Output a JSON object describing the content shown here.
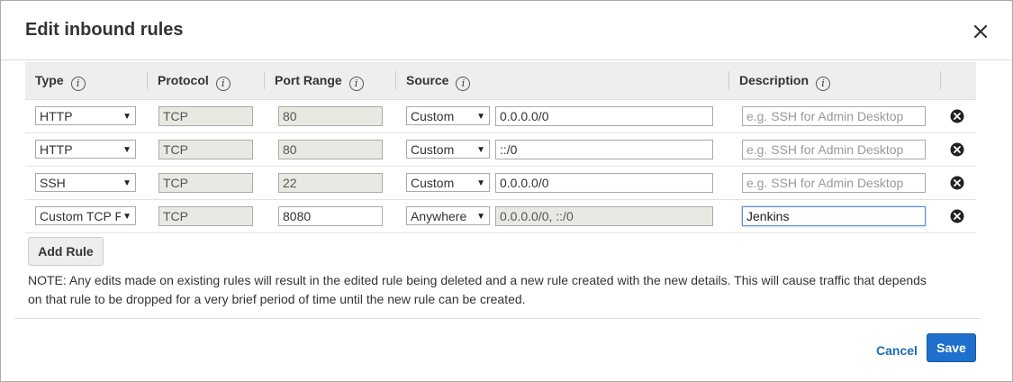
{
  "dialog": {
    "title": "Edit inbound rules",
    "close_icon": "close-icon"
  },
  "table": {
    "headers": {
      "type": "Type",
      "protocol": "Protocol",
      "port_range": "Port Range",
      "source": "Source",
      "description": "Description"
    },
    "info_glyph": "i",
    "rows": [
      {
        "type": "HTTP",
        "protocol": "TCP",
        "port": "80",
        "source_mode": "Custom",
        "source_value": "0.0.0.0/0",
        "description_value": "",
        "description_placeholder": "e.g. SSH for Admin Desktop"
      },
      {
        "type": "HTTP",
        "protocol": "TCP",
        "port": "80",
        "source_mode": "Custom",
        "source_value": "::/0",
        "description_value": "",
        "description_placeholder": "e.g. SSH for Admin Desktop"
      },
      {
        "type": "SSH",
        "protocol": "TCP",
        "port": "22",
        "source_mode": "Custom",
        "source_value": "0.0.0.0/0",
        "description_value": "",
        "description_placeholder": "e.g. SSH for Admin Desktop"
      },
      {
        "type": "Custom TCP F",
        "protocol": "TCP",
        "port": "8080",
        "source_mode": "Anywhere",
        "source_value": "0.0.0.0/0, ::/0",
        "description_value": "Jenkins",
        "description_placeholder": "e.g. SSH for Admin Desktop"
      }
    ],
    "dropdown_arrow": "▼"
  },
  "actions": {
    "add_rule": "Add Rule",
    "note": "NOTE: Any edits made on existing rules will result in the edited rule being deleted and a new rule created with the new details. This will cause traffic that depends on that rule to be dropped for a very brief period of time until the new rule can be created.",
    "cancel": "Cancel",
    "save": "Save"
  },
  "colors": {
    "primary": "#1f6fcc",
    "link": "#1f6bb5"
  }
}
